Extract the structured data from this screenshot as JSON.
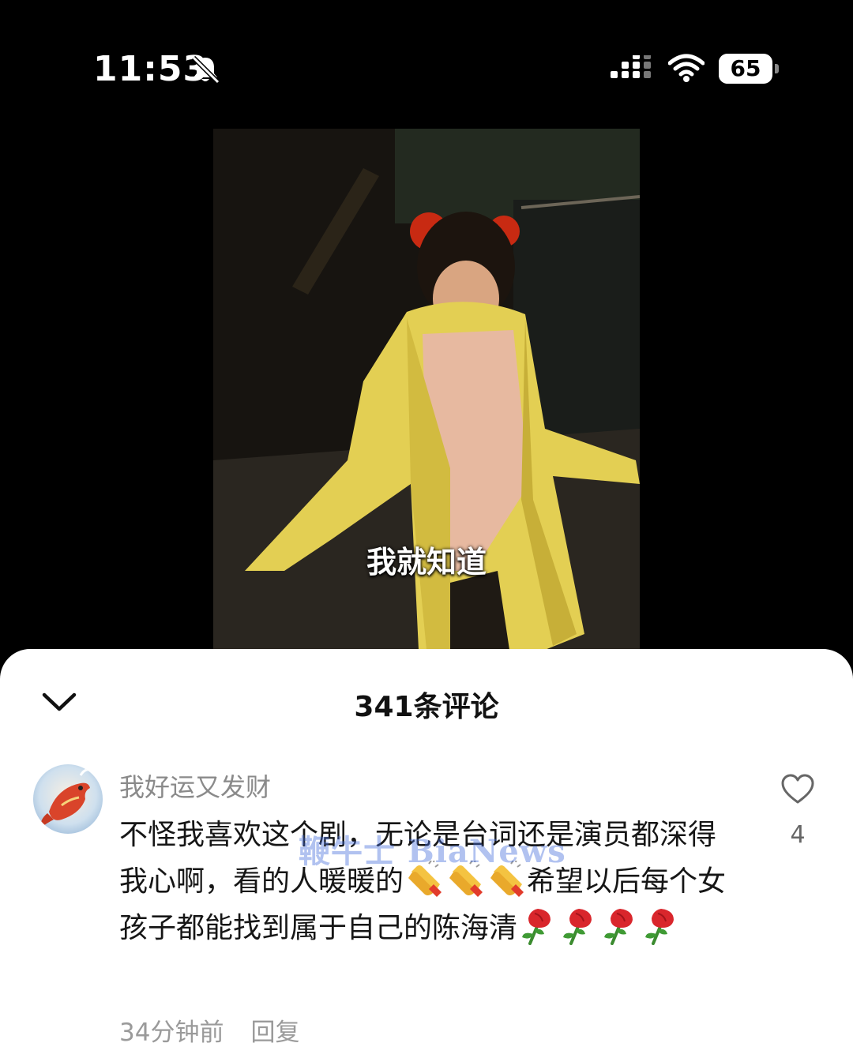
{
  "status_bar": {
    "time": "11:53",
    "battery_percent": "65",
    "battery_level": 0.65,
    "icons": [
      "bell-off-icon",
      "signal-icon",
      "wifi-icon",
      "battery-icon"
    ]
  },
  "video": {
    "subtitle": "我就知道"
  },
  "comments_panel": {
    "title": "341条评论",
    "collapse_icon": "chevron-down-icon"
  },
  "comment": {
    "username": "我好运又发财",
    "text_part1": "不怪我喜欢这个剧，无论是台词还是演员都深得我心啊，看的人暖暖的",
    "clap_emoji_count": 3,
    "text_part2": "希望以后每个女孩子都能找到属于自己的陈海清",
    "rose_emoji_count": 4,
    "time_ago": "34分钟前",
    "reply_label": "回复",
    "like_count": "4",
    "like_icon": "heart-outline-icon"
  },
  "watermark": "鞭牛士 BiaNews",
  "colors": {
    "background": "#000000",
    "sheet": "#ffffff",
    "secondary_text": "#8a8a8a",
    "watermark": "#466edc"
  }
}
